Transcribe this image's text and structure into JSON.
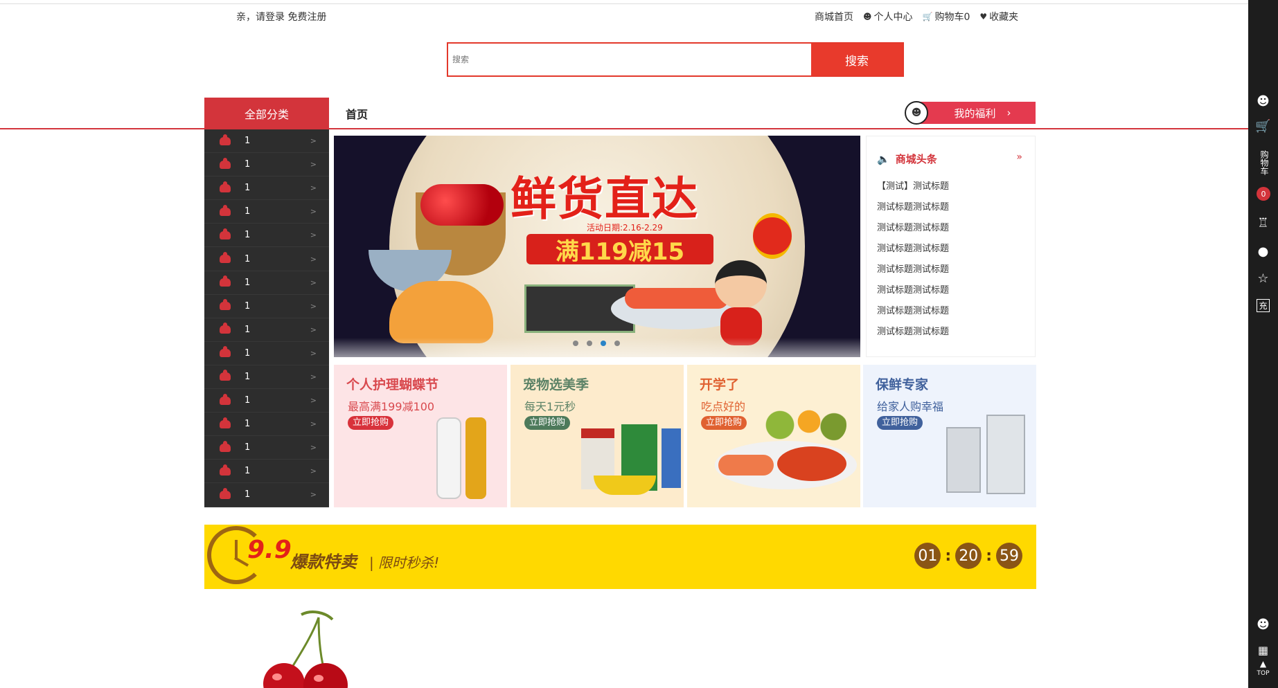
{
  "topbar": {
    "login_text": "亲，请登录",
    "register_text": "免费注册",
    "nav": [
      {
        "label": "商城首页",
        "icon": ""
      },
      {
        "label": "个人中心",
        "icon": "user-icon"
      },
      {
        "label": "购物车0",
        "icon": "cart-icon"
      },
      {
        "label": "收藏夹",
        "icon": "heart-icon"
      }
    ]
  },
  "search": {
    "placeholder": "搜索",
    "button": "搜索"
  },
  "nav": {
    "all_categories": "全部分类",
    "home": "首页",
    "welfare": "我的福利",
    "welfare_arrow": "›"
  },
  "categories": [
    "1",
    "1",
    "1",
    "1",
    "1",
    "1",
    "1",
    "1",
    "1",
    "1",
    "1",
    "1",
    "1",
    "1",
    "1",
    "1"
  ],
  "category_arrow": ">",
  "banner": {
    "title": "鲜货直达",
    "date": "活动日期:2.16-2.29",
    "deal": "满119减15",
    "slides": 4,
    "active_slide": 3
  },
  "news": {
    "header": "商城头条",
    "more": "»",
    "items": [
      "【测试】测试标题",
      "测试标题测试标题",
      "测试标题测试标题",
      "测试标题测试标题",
      "测试标题测试标题",
      "测试标题测试标题",
      "测试标题测试标题",
      "测试标题测试标题"
    ]
  },
  "promos": [
    {
      "title": "个人护理蝴蝶节",
      "subtitle": "最高满199减100",
      "button": "立即抢购"
    },
    {
      "title": "宠物选美季",
      "subtitle": "每天1元秒",
      "button": "立即抢购"
    },
    {
      "title": "开学了",
      "subtitle": "吃点好的",
      "button": "立即抢购"
    },
    {
      "title": "保鲜专家",
      "subtitle": "给家人购幸福",
      "button": "立即抢购"
    }
  ],
  "flash_sale": {
    "price": "9.9",
    "slogan": "爆款特卖",
    "subtitle": "| 限时秒杀!",
    "timer": {
      "hours": "01",
      "minutes": "20",
      "seconds": "59"
    },
    "separator": ":"
  },
  "sidebar": {
    "cart_label": "购物车",
    "cart_count": "0",
    "top_label": "TOP"
  },
  "colors": {
    "primary": "#d3343b",
    "search_red": "#e83a2c",
    "flash_yellow": "#ffd900",
    "sidebar": "#1d1d1d"
  }
}
